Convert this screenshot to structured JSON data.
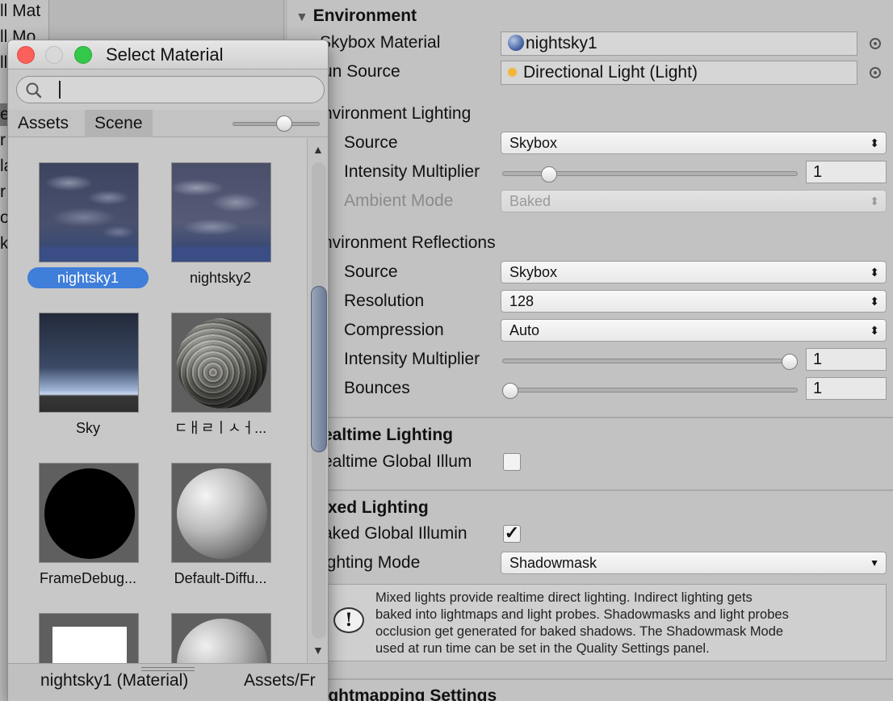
{
  "background_list": {
    "rows": [
      "ll Mat",
      "ll Mo",
      "ll",
      "e",
      "r",
      "la",
      "r",
      "o",
      "k"
    ]
  },
  "inspector": {
    "environment_header": "Environment",
    "skybox_material_label": "Skybox Material",
    "skybox_material_value": "nightsky1",
    "sun_source_label": "un Source",
    "sun_source_value": "Directional Light (Light)",
    "env_lighting_header": "nvironment Lighting",
    "env_source_label": "Source",
    "env_source_value": "Skybox",
    "env_intensity_label": "Intensity Multiplier",
    "env_intensity_value": "1",
    "env_intensity_fraction": 0.14,
    "ambient_mode_label": "Ambient Mode",
    "ambient_mode_value": "Baked",
    "env_reflections_header": "nvironment Reflections",
    "refl_source_label": "Source",
    "refl_source_value": "Skybox",
    "resolution_label": "Resolution",
    "resolution_value": "128",
    "compression_label": "Compression",
    "compression_value": "Auto",
    "refl_intensity_label": "Intensity Multiplier",
    "refl_intensity_value": "1",
    "refl_intensity_fraction": 1.0,
    "bounces_label": "Bounces",
    "bounces_value": "1",
    "bounces_fraction": 0.0,
    "realtime_header": "ealtime Lighting",
    "realtime_gi_label": "ealtime Global Illum",
    "realtime_gi_checked": false,
    "mixed_header": "ixed Lighting",
    "baked_gi_label": "aked Global Illumin",
    "baked_gi_checked": true,
    "lighting_mode_label": "ighting Mode",
    "lighting_mode_value": "Shadowmask",
    "help_lines": [
      "Mixed lights provide realtime direct lighting. Indirect lighting gets",
      "baked into lightmaps and light probes. Shadowmasks and light probes",
      "occlusion get generated for baked shadows. The Shadowmask Mode",
      "used at run time can be set in the Quality Settings panel."
    ],
    "lightmapping_header": "Lightmapping Settings"
  },
  "picker": {
    "title": "Select Material",
    "search_value": "",
    "tabs": [
      "Assets",
      "Scene"
    ],
    "active_tab": "Assets",
    "items": [
      {
        "name": "nightsky1",
        "selected": true,
        "preview": "night-sky"
      },
      {
        "name": "nightsky2",
        "selected": false,
        "preview": "night-sky"
      },
      {
        "name": "Sky",
        "selected": false,
        "preview": "gradient-sky"
      },
      {
        "name": "ㄷㅐㄹㅣㅅㅓ...",
        "selected": false,
        "preview": "rock-sphere"
      },
      {
        "name": "FrameDebug...",
        "selected": false,
        "preview": "black-sphere"
      },
      {
        "name": "Default-Diffu...",
        "selected": false,
        "preview": "grey-sphere"
      },
      {
        "name": "",
        "selected": false,
        "preview": "white-quad"
      },
      {
        "name": "",
        "selected": false,
        "preview": "grey-sphere"
      }
    ],
    "footer_name": "nightsky1 (Material)",
    "footer_path": "Assets/Fr"
  },
  "colors": {
    "selection_blue": "#3f7ed9",
    "panel_grey": "#c2c2c2",
    "close_red": "#fc605b",
    "zoom_green": "#34c84a"
  }
}
